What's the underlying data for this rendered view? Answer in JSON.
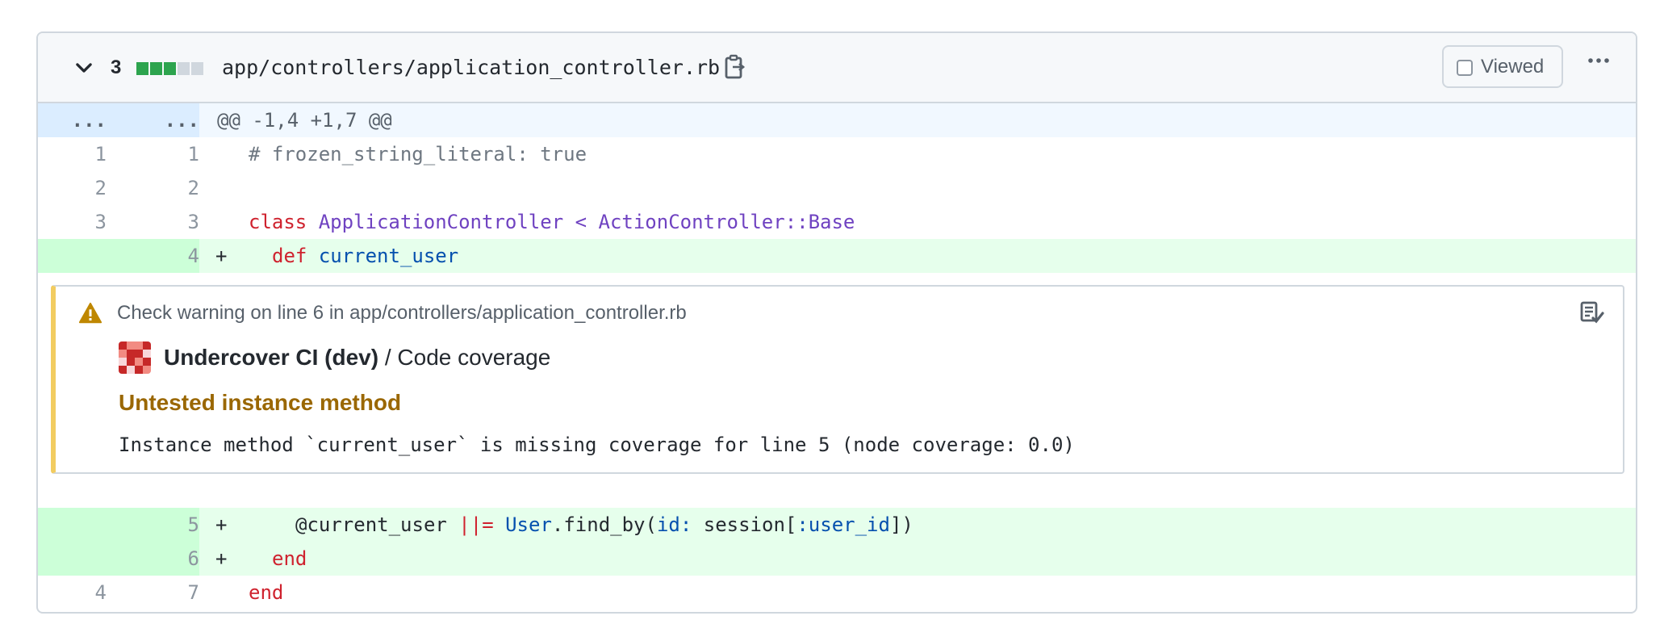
{
  "file": {
    "changes_count": "3",
    "diffstat": [
      "#2da44e",
      "#2da44e",
      "#2da44e",
      "#d0d7de",
      "#d0d7de"
    ],
    "path": "app/controllers/application_controller.rb",
    "viewed_label": "Viewed",
    "viewed_checked": false
  },
  "hunk": {
    "old": "...",
    "new": "...",
    "header": "@@ -1,4 +1,7 @@"
  },
  "lines": [
    {
      "old": "1",
      "new": "1",
      "marker": "",
      "code": "# frozen_string_literal: true"
    },
    {
      "old": "2",
      "new": "2",
      "marker": "",
      "code": ""
    },
    {
      "old": "3",
      "new": "3",
      "marker": "",
      "code": "class ApplicationController < ActionController::Base"
    },
    {
      "old": "",
      "new": "4",
      "marker": "+",
      "code": "  def current_user"
    },
    {
      "old": "",
      "new": "5",
      "marker": "+",
      "code": "    @current_user ||= User.find_by(id: session[:user_id])"
    },
    {
      "old": "",
      "new": "6",
      "marker": "+",
      "code": "  end"
    },
    {
      "old": "4",
      "new": "7",
      "marker": "",
      "code": "end"
    }
  ],
  "code_tokens": {
    "l1_comment": "# frozen_string_literal: true",
    "l3_class": "class",
    "l3_name": "ApplicationController",
    "l3_lt": "<",
    "l3_base": "ActionController::Base",
    "l4_def": "def",
    "l4_name": "current_user",
    "l5_ivar": "@current_user",
    "l5_op": "||=",
    "l5_const": "User",
    "l5_call": ".find_by(",
    "l5_key": "id:",
    "l5_session": " session[",
    "l5_sym": ":user_id",
    "l5_close": "])",
    "l6_end": "end",
    "l7_end": "end"
  },
  "annotation": {
    "level_color": "#f2cc60",
    "title": "Check warning on line 6 in app/controllers/application_controller.rb",
    "app_name": "Undercover CI (dev)",
    "check_name": " / Code coverage",
    "heading": "Untested instance method",
    "message": "Instance method `current_user` is missing coverage for line 5 (node coverage: 0.0)"
  },
  "icons": {
    "collapse": "chevron-down-icon",
    "copy": "copy-icon",
    "menu": "kebab-horizontal-icon",
    "warning": "alert-icon",
    "copy_check": "copy-checklist-icon"
  }
}
